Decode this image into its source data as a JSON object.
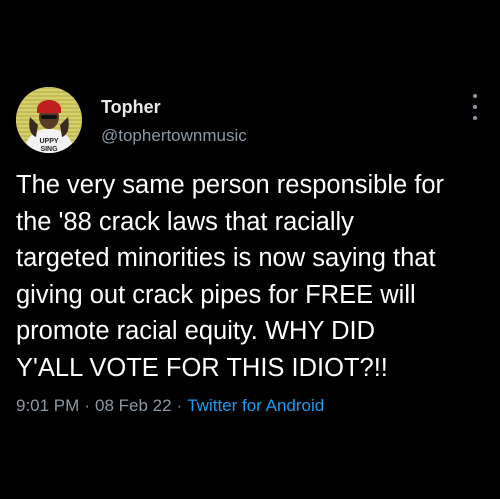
{
  "tweet": {
    "display_name": "Topher",
    "handle": "@tophertownmusic",
    "text_lines": [
      "The very same person responsible for",
      "the '88 crack laws that racially",
      "targeted minorities is now saying that",
      "giving out crack pipes for FREE will",
      "promote racial equity. WHY DID",
      "Y'ALL VOTE FOR THIS IDIOT?!!"
    ],
    "time": "9:01 PM",
    "separator": "·",
    "date": "08 Feb 22",
    "source": "Twitter for Android",
    "avatar_shirt_text": "UPPY SING"
  },
  "colors": {
    "background": "#000000",
    "primary_text": "#ffffff",
    "secondary_text": "#8b98a5",
    "link": "#1d9bf0"
  },
  "icons": {
    "more": "vertical-ellipsis-icon",
    "avatar": "profile-photo"
  }
}
